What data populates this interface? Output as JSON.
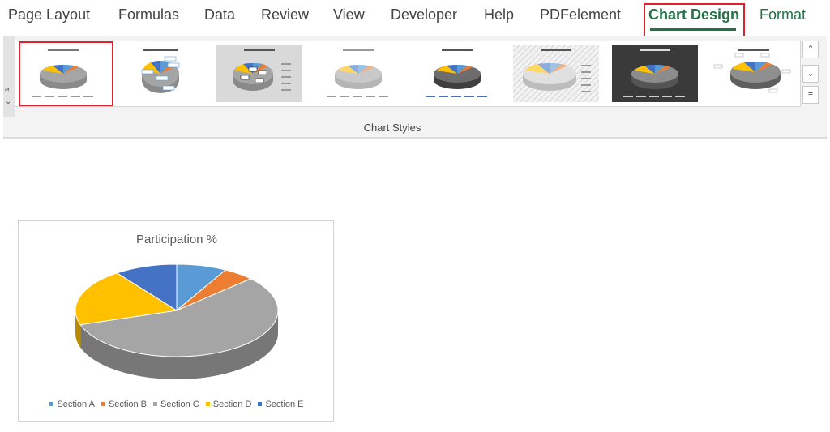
{
  "tabs": [
    {
      "label": "Page Layout",
      "active": false
    },
    {
      "label": "Formulas",
      "active": false
    },
    {
      "label": "Data",
      "active": false
    },
    {
      "label": "Review",
      "active": false
    },
    {
      "label": "View",
      "active": false
    },
    {
      "label": "Developer",
      "active": false
    },
    {
      "label": "Help",
      "active": false
    },
    {
      "label": "PDFelement",
      "active": false
    },
    {
      "label": "Chart Design",
      "active": true
    },
    {
      "label": "Format",
      "active": false
    }
  ],
  "ribbon": {
    "group_label": "Chart Styles",
    "left_edge_glyph": "e",
    "left_edge_arrow": "⌄",
    "scroll_up_icon": "chevron-up-icon",
    "scroll_down_icon": "chevron-down-icon",
    "expand_icon": "more-icon",
    "styles": [
      {
        "id": 1,
        "theme": "light",
        "selected": true
      },
      {
        "id": 2,
        "theme": "light-callouts",
        "selected": false
      },
      {
        "id": 3,
        "theme": "grey-gradient",
        "selected": false
      },
      {
        "id": 4,
        "theme": "light-soft",
        "selected": false
      },
      {
        "id": 5,
        "theme": "light-dark-pie",
        "selected": false
      },
      {
        "id": 6,
        "theme": "hatched",
        "selected": false
      },
      {
        "id": 7,
        "theme": "dark",
        "selected": false
      },
      {
        "id": 8,
        "theme": "light-labels",
        "selected": false
      }
    ]
  },
  "colors": {
    "accent": "#217346",
    "highlight": "#e0202a",
    "section_a": "#5b9bd5",
    "section_b": "#ed7d31",
    "section_c": "#a5a5a5",
    "section_d": "#ffc000",
    "section_e": "#4472c4"
  },
  "chart_data": {
    "type": "pie",
    "title": "Participation %",
    "categories": [
      "Section A",
      "Section B",
      "Section C",
      "Section D",
      "Section E"
    ],
    "values": [
      8,
      5,
      57,
      20,
      10
    ],
    "legend_position": "bottom",
    "style": "3d"
  }
}
